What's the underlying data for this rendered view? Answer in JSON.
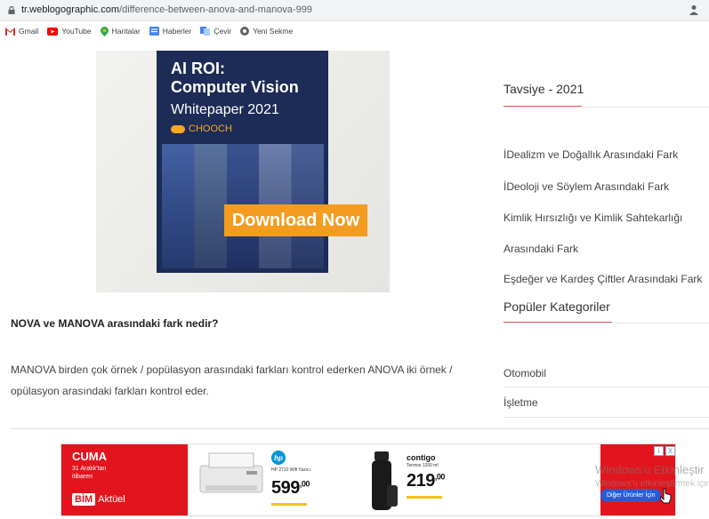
{
  "browser": {
    "url_domain": "tr.weblogographic.com",
    "url_path": "/difference-between-anova-and-manova-999",
    "bookmarks": [
      {
        "label": "Gmail",
        "icon": "gmail-icon"
      },
      {
        "label": "YouTube",
        "icon": "youtube-icon"
      },
      {
        "label": "Haritalar",
        "icon": "maps-icon"
      },
      {
        "label": "Haberler",
        "icon": "news-icon"
      },
      {
        "label": "Çevir",
        "icon": "translate-icon"
      },
      {
        "label": "Yeni Sekme",
        "icon": "chrome-icon"
      }
    ]
  },
  "ad_image": {
    "title_line1": "AI ROI:",
    "title_line2": "Computer Vision",
    "subtitle": "Whitepaper 2021",
    "brand": "CHOOCH",
    "button": "Download Now"
  },
  "article": {
    "heading": "NOVA ve MANOVA arasındaki fark nedir?",
    "body_line1": "MANOVA birden çok örnek / popülasyon arasındaki farkları kontrol ederken ANOVA iki örnek /",
    "body_line2": "opülasyon arasındaki farkları kontrol eder."
  },
  "sidebar": {
    "recommended_title": "Tavsiye - 2021",
    "recommended_links": [
      "İDealizm ve Doğallık Arasındaki Fark",
      "İDeoloji ve Söylem Arasındaki Fark",
      "Kimlik Hırsızlığı ve Kimlik Sahtekarlığı",
      "Arasındaki Fark",
      "Eşdeğer ve Kardeş Çiftler Arasındaki Fark"
    ],
    "categories_title": "Popüler Kategoriler",
    "categories": [
      "Otomobil",
      "İşletme"
    ]
  },
  "banner": {
    "day": "CUMA",
    "date_line1": "31 Aralık'tan",
    "date_line2": "itibaren",
    "store": "BİM",
    "store_suffix": "Aktüel",
    "hp_logo": "hp",
    "hp_model": "HP 2710 Wifi Yazıcı",
    "price1": "599",
    "price1_cents": ",00",
    "contigo_brand": "contigo",
    "contigo_model": "Termos 1200 ml",
    "price2": "219",
    "price2_cents": ",00",
    "more_button": "Diğer Ürünler İçin",
    "adchoices_info": "i",
    "adchoices_close": "X"
  },
  "watermark": {
    "line1": "Windows'u Etkinleştir",
    "line2": "Windows'u etkinleştirmek için"
  },
  "colors": {
    "accent_red": "#e25d5d",
    "ad_orange": "#f39c1f",
    "ad_navy": "#1d2c56",
    "bim_red": "#e3141d"
  }
}
